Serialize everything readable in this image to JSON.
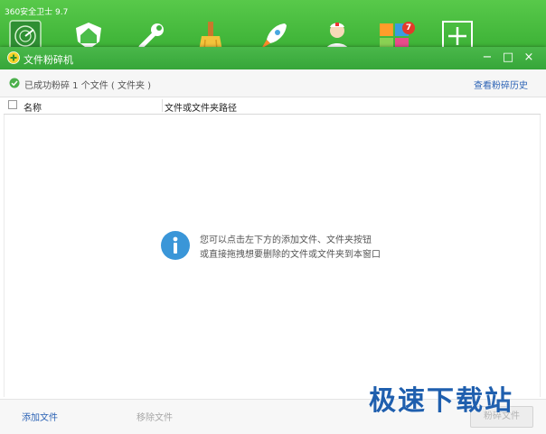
{
  "app": {
    "title": "360安全卫士 9.7",
    "toolbar_icons": [
      "radar-icon",
      "home-shield-icon",
      "wrench-icon",
      "broom-icon",
      "rocket-icon",
      "doctor-icon",
      "apps-icon",
      "plus-icon"
    ],
    "badge_count": "7"
  },
  "dialog": {
    "title": "文件粉碎机",
    "window_buttons": {
      "minimize": "−",
      "maximize": "□",
      "close": "×"
    },
    "status_text": "已成功粉碎 1 个文件 ( 文件夹 )",
    "history_link": "查看粉碎历史",
    "columns": {
      "name": "名称",
      "path": "文件或文件夹路径"
    },
    "hint_line1": "您可以点击左下方的添加文件、文件夹按钮",
    "hint_line2": "或直接拖拽想要删除的文件或文件夹到本窗口",
    "footer": {
      "add_file": "添加文件",
      "remove_file": "移除文件",
      "shred_file": "粉碎文件"
    }
  },
  "watermark": "极速下载站",
  "colors": {
    "green_header": "#3aa83c",
    "link_blue": "#2c63b5",
    "info_blue": "#3a96d8"
  }
}
